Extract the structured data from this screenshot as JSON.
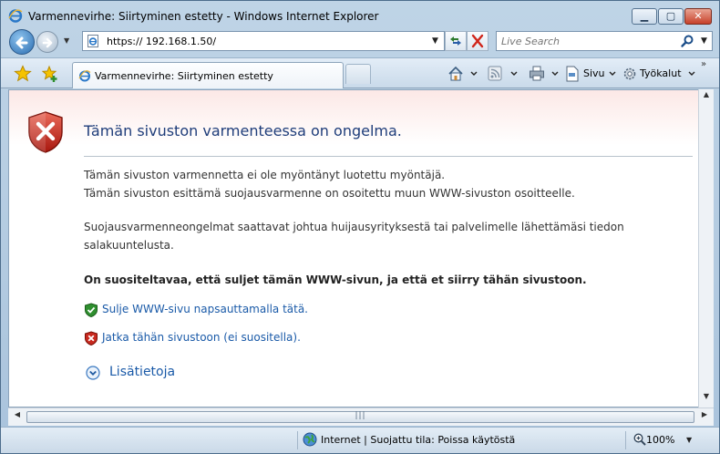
{
  "window": {
    "title": "Varmennevirhe: Siirtyminen estetty - Windows Internet Explorer",
    "controls": {
      "minimize": "▁",
      "maximize": "▢",
      "close": "✕"
    }
  },
  "address_bar": {
    "url": "https:// 192.168.1.50/",
    "search_placeholder": "Live Search"
  },
  "tab": {
    "label": "Varmennevirhe: Siirtyminen estetty"
  },
  "command_bar": {
    "page_label": "Sivu",
    "tools_label": "Työkalut",
    "overflow": "»"
  },
  "content": {
    "heading": "Tämän sivuston varmenteessa on ongelma.",
    "paragraph1_line1": "Tämän sivuston varmennetta ei ole myöntänyt luotettu myöntäjä.",
    "paragraph1_line2": "Tämän sivuston esittämä suojausvarmenne on osoitettu muun WWW-sivuston osoitteelle.",
    "paragraph2_line1": "Suojausvarmenneongelmat saattavat johtua huijausyrityksestä tai palvelimelle lähettämäsi tiedon",
    "paragraph2_line2": "salakuuntelusta.",
    "recommendation": "On suositeltavaa, että suljet tämän WWW-sivun, ja että et siirry tähän sivustoon.",
    "close_link": "Sulje WWW-sivu napsauttamalla tätä.",
    "continue_link": "Jatka tähän sivustoon (ei suositella).",
    "more_info": "Lisätietoja"
  },
  "status_bar": {
    "zone_text": "Internet | Suojattu tila: Poissa käytöstä",
    "zoom": "100%"
  },
  "colors": {
    "heading": "#1f3d7a",
    "link": "#1a5aa8",
    "shield_red": "#c8291f",
    "shield_green": "#2f8f2f"
  }
}
